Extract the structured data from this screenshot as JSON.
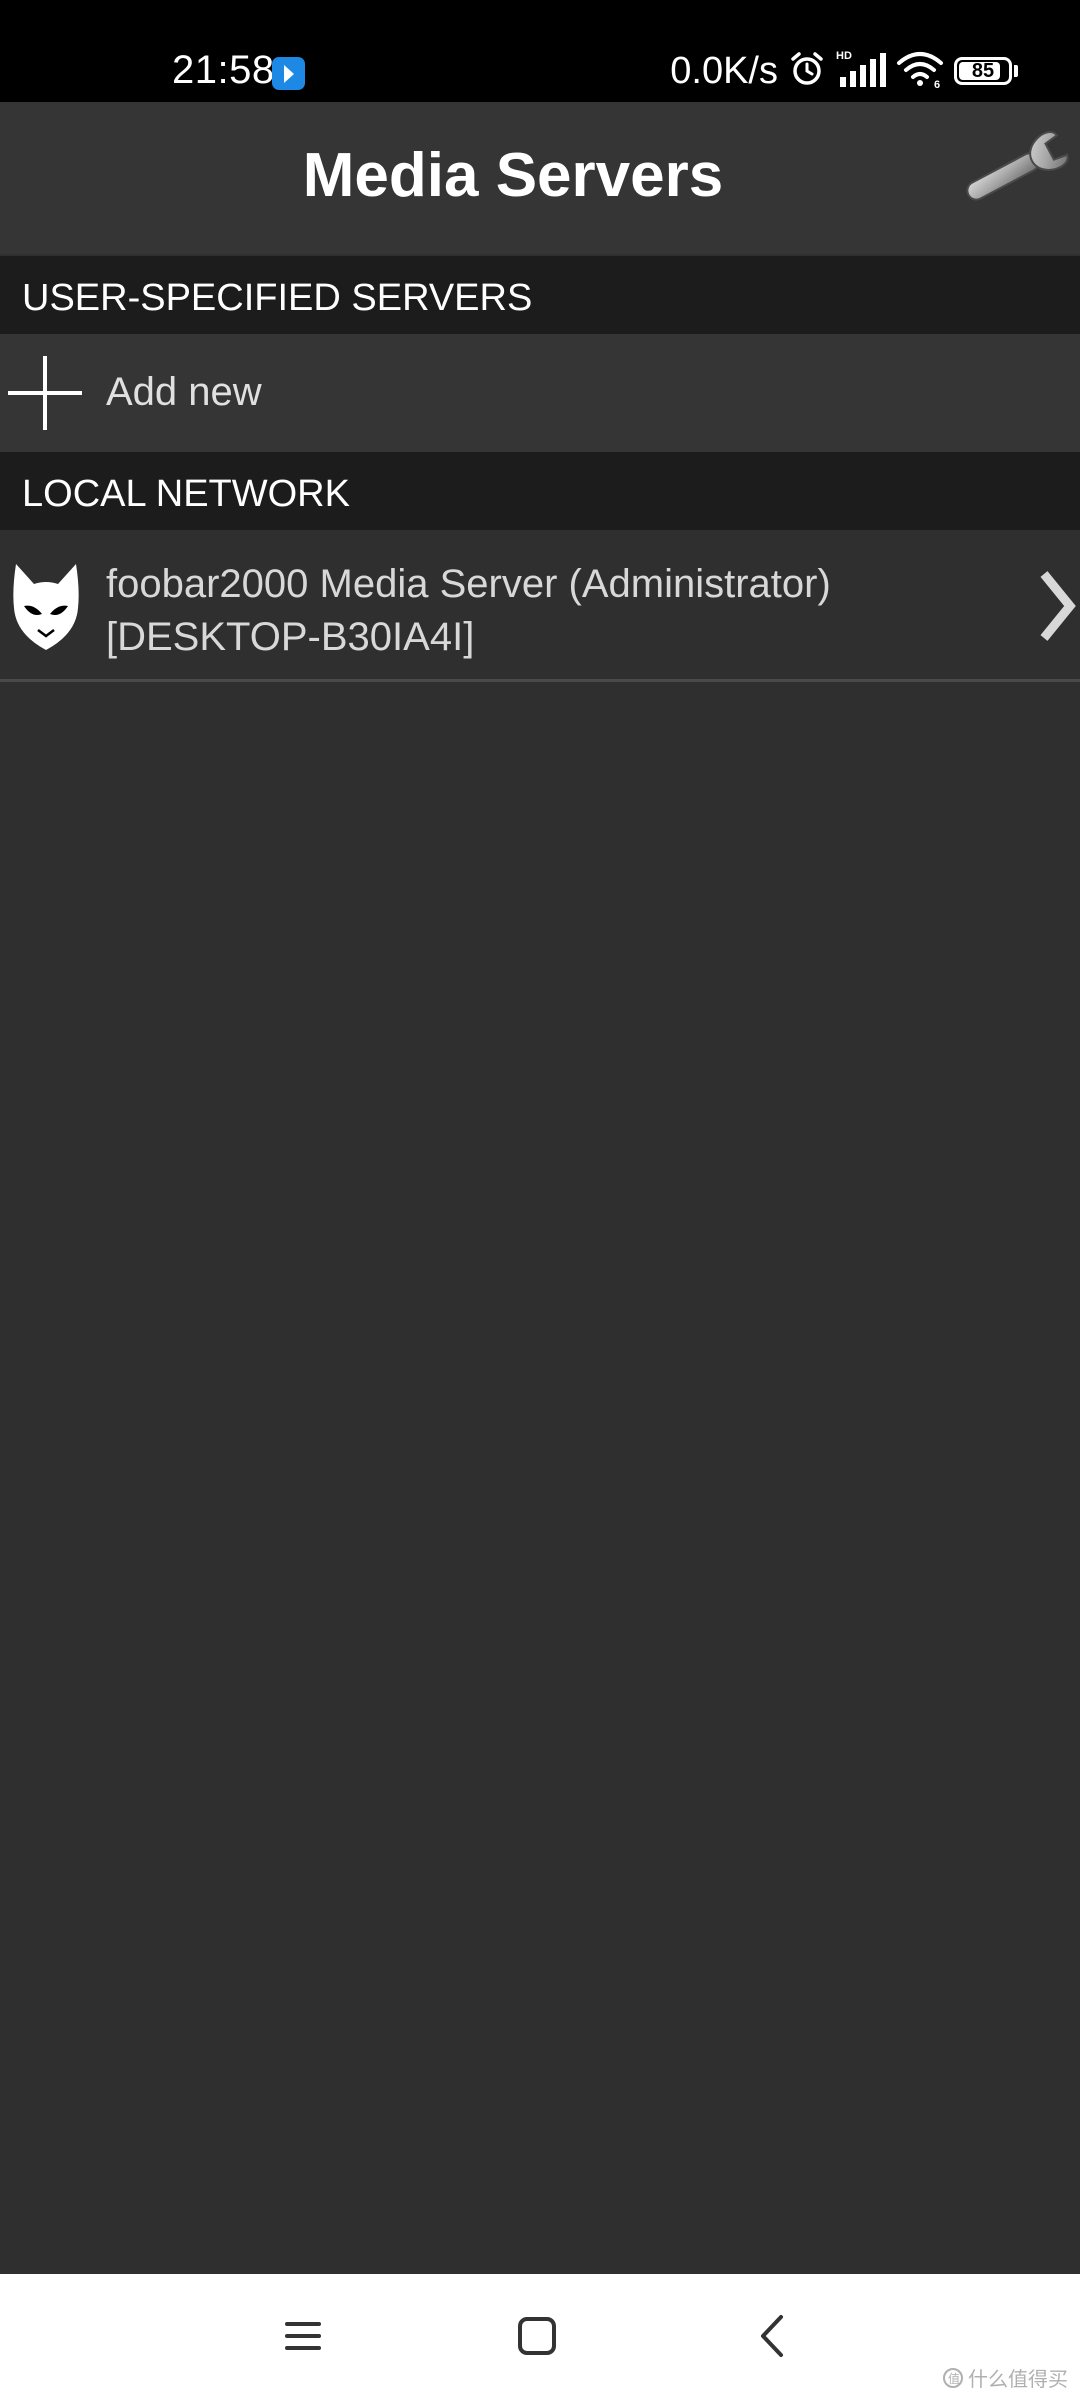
{
  "status_bar": {
    "time": "21:58",
    "network_speed": "0.0K/s",
    "battery_level": "85",
    "battery_fraction": 0.85,
    "icons": [
      "app-notification-icon",
      "alarm-icon",
      "hd-signal-icon",
      "wifi-icon",
      "battery-icon"
    ]
  },
  "header": {
    "title": "Media Servers",
    "settings_icon": "wrench-icon"
  },
  "sections": {
    "user_specified": {
      "title": "USER-SPECIFIED SERVERS",
      "add_label": "Add new"
    },
    "local_network": {
      "title": "LOCAL NETWORK",
      "servers": [
        {
          "name": "foobar2000 Media Server (Administrator)",
          "host": "[DESKTOP-B30IA4I]",
          "icon": "foobar2000-icon"
        }
      ]
    }
  },
  "nav_bar": {
    "items": [
      "menu-icon",
      "home-icon",
      "back-icon"
    ]
  },
  "watermark": {
    "text": "什么值得买"
  },
  "colors": {
    "background": "#2f2f2f",
    "title_bar": "#353535",
    "section_header": "#1c1c1c",
    "status_bar": "#000000",
    "nav_bar": "#ffffff"
  }
}
